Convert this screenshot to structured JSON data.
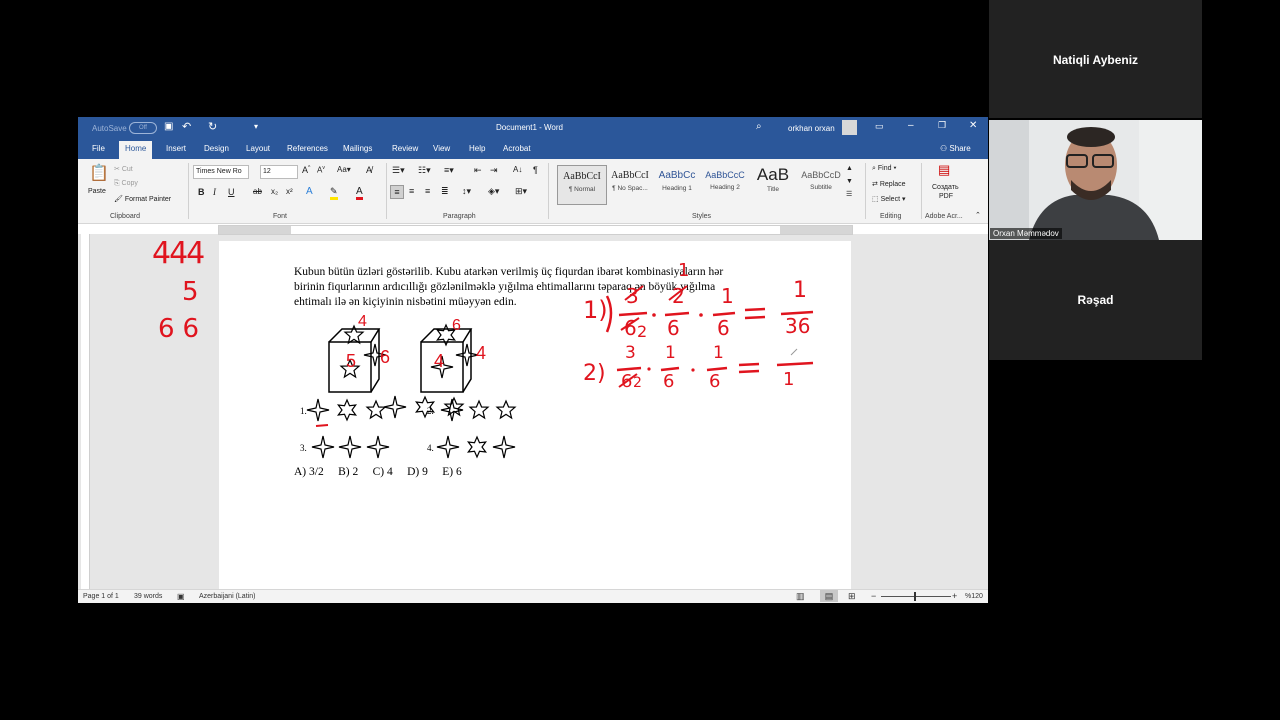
{
  "meeting": {
    "participants": [
      {
        "name": "Natiqli Aybeniz"
      },
      {
        "name": "Orxan Məmmədov"
      },
      {
        "name": "Rəşad"
      }
    ]
  },
  "word": {
    "titlebar": {
      "autosave_label": "AutoSave",
      "autosave_state": "Off",
      "document_title": "Document1 - Word",
      "user_name": "orkhan orxan"
    },
    "tabs": [
      "File",
      "Home",
      "Insert",
      "Design",
      "Layout",
      "References",
      "Mailings",
      "Review",
      "View",
      "Help",
      "Acrobat"
    ],
    "share_label": "Share",
    "ribbon": {
      "clipboard": {
        "paste": "Paste",
        "cut": "Cut",
        "copy": "Copy",
        "format_painter": "Format Painter",
        "label": "Clipboard"
      },
      "font": {
        "name": "Times New Ro",
        "size": "12",
        "label": "Font"
      },
      "paragraph": {
        "label": "Paragraph"
      },
      "styles": {
        "items": [
          {
            "sample": "AaBbCcI",
            "name": "¶ Normal"
          },
          {
            "sample": "AaBbCcI",
            "name": "¶ No Spac..."
          },
          {
            "sample": "AaBbCc",
            "name": "Heading 1"
          },
          {
            "sample": "AaBbCcC",
            "name": "Heading 2"
          },
          {
            "sample": "AaB",
            "name": "Title"
          },
          {
            "sample": "AaBbCcD",
            "name": "Subtitle"
          }
        ],
        "label": "Styles"
      },
      "editing": {
        "find": "Find",
        "replace": "Replace",
        "select": "Select",
        "label": "Editing"
      },
      "adobe": {
        "create_pdf_1": "Создать",
        "create_pdf_2": "PDF",
        "label": "Adobe Acr..."
      }
    },
    "document": {
      "question_lines": [
        "Kubun bütün üzləri göstərilib. Kubu atarkən verilmiş üç fiqurdan ibarət kombinasiyaların hər",
        "birinin fiqurlarının ardıcıllığı gözlənilməklə yığılma  ehtimallarını təparaq ən böyük yığılma",
        "ehtimalı ilə ən kiçiyinin nisbətini müəyyən edin."
      ],
      "option_numbers": [
        "1.",
        "2.",
        "3.",
        "4."
      ],
      "answers": "A) 3/2     B) 2     C) 4     D) 9     E) 6",
      "handwriting": {
        "left_counts": [
          "444",
          "5",
          "66"
        ],
        "cube_numbers": [
          "4",
          "5",
          "6",
          "6",
          "4",
          "4"
        ],
        "eq1": {
          "label": "1)",
          "n1": "3",
          "d1": "6",
          "n2": "2",
          "d2": "6",
          "n3": "1",
          "d3": "6",
          "result_n": "1",
          "result_d": "36",
          "strike_n": "1",
          "strike_d": "2"
        },
        "eq2": {
          "label": "2)",
          "n1": "3",
          "d1": "6",
          "n2": "1",
          "d2": "6",
          "n3": "1",
          "d3": "6",
          "result_d": "1",
          "strike_d": "2"
        }
      }
    },
    "statusbar": {
      "page": "Page 1 of 1",
      "words": "39 words",
      "language": "Azerbaijani (Latin)",
      "zoom": "%120"
    }
  },
  "colors": {
    "word_blue": "#2b579a",
    "ink_red": "#e0141e"
  }
}
